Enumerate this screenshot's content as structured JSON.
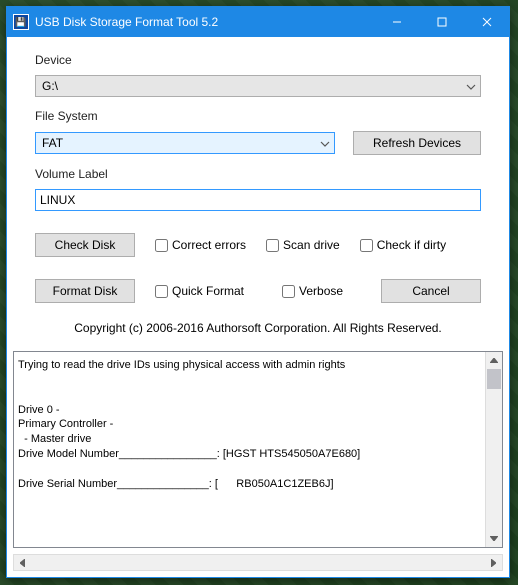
{
  "window": {
    "title": "USB Disk Storage Format Tool 5.2"
  },
  "labels": {
    "device": "Device",
    "filesystem": "File System",
    "volume": "Volume Label"
  },
  "device": {
    "selected": "G:\\"
  },
  "filesystem": {
    "selected": "FAT"
  },
  "buttons": {
    "refresh": "Refresh Devices",
    "checkdisk": "Check Disk",
    "format": "Format Disk",
    "cancel": "Cancel"
  },
  "volume": {
    "value": "LINUX"
  },
  "checks": {
    "correct": "Correct errors",
    "scan": "Scan drive",
    "dirty": "Check if dirty",
    "quick": "Quick Format",
    "verbose": "Verbose"
  },
  "copyright": "Copyright (c) 2006-2016 Authorsoft Corporation. All Rights Reserved.",
  "log": "Trying to read the drive IDs using physical access with admin rights\n\n\nDrive 0 - \nPrimary Controller - \n  - Master drive\nDrive Model Number________________: [HGST HTS545050A7E680]\n\nDrive Serial Number_______________: [      RB050A1C1ZEB6J]"
}
